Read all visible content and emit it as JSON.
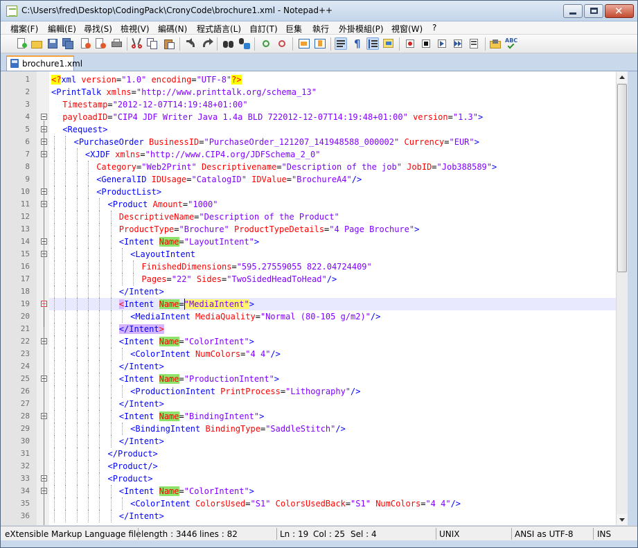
{
  "window": {
    "title": "C:\\Users\\fred\\Desktop\\CodingPack\\CronyCode\\brochure1.xml - Notepad++"
  },
  "menu": [
    "檔案(F)",
    "編輯(E)",
    "尋找(S)",
    "檢視(V)",
    "編碼(N)",
    "程式語言(L)",
    "自訂(T)",
    "巨集",
    "執行",
    "外掛模組(P)",
    "視窗(W)",
    "?"
  ],
  "toolbar": {
    "icons": [
      "new-file-icon",
      "open-file-icon",
      "save-icon",
      "save-all-icon",
      "close-icon",
      "close-all-icon",
      "print-icon",
      "cut-icon",
      "copy-icon",
      "paste-icon",
      "undo-icon",
      "redo-icon",
      "find-icon",
      "replace-icon",
      "zoom-in-icon",
      "zoom-out-icon",
      "sync-vertical-icon",
      "sync-horizontal-icon",
      "word-wrap-icon",
      "show-all-chars-icon",
      "indent-guide-icon",
      "language-define-icon",
      "record-macro-icon",
      "stop-macro-icon",
      "play-macro-icon",
      "run-macro-multiple-icon",
      "save-macro-icon",
      "function-list-icon",
      "spell-check-icon"
    ]
  },
  "tab": {
    "label": "brochure1.xml"
  },
  "editor": {
    "lines": [
      {
        "n": "1",
        "indent": 0,
        "html": "<span class=\"pi\">&lt;?</span><span class=\"tag\">xml</span> <span class=\"attr\">version</span>=<span class=\"val\">\"1.0\"</span> <span class=\"attr\">encoding</span>=<span class=\"val\">\"UTF-8\"</span><span class=\"pi\">?&gt;</span>"
      },
      {
        "n": "2",
        "indent": 0,
        "html": "<span class=\"tag\">&lt;PrintTalk</span> <span class=\"attr\">xmlns</span>=<span class=\"val\">\"http://www.printtalk.org/schema_13\"</span>"
      },
      {
        "n": "3",
        "indent": 1,
        "html": "<span class=\"attr\">Timestamp</span>=<span class=\"val\">\"2012-12-07T14:19:48+01:00\"</span>"
      },
      {
        "n": "4",
        "indent": 1,
        "html": "<span class=\"attr\">payloadID</span>=<span class=\"val\">\"CIP4 JDF Writer Java 1.4a BLD 722012-12-07T14:19:48+01:00\"</span> <span class=\"attr\">version</span>=<span class=\"val\">\"1.3\"</span><span class=\"tag\">&gt;</span>"
      },
      {
        "n": "5",
        "indent": 1,
        "html": "<span class=\"tag\">&lt;Request&gt;</span>"
      },
      {
        "n": "6",
        "indent": 2,
        "html": "<span class=\"tag\">&lt;PurchaseOrder</span> <span class=\"attr\">BusinessID</span>=<span class=\"val\">\"PurchaseOrder_121207_141948588_000002\"</span> <span class=\"attr\">Currency</span>=<span class=\"val\">\"EUR\"</span><span class=\"tag\">&gt;</span>"
      },
      {
        "n": "7",
        "indent": 3,
        "html": "<span class=\"tag\">&lt;XJDF</span> <span class=\"attr\">xmlns</span>=<span class=\"val\">\"http://www.CIP4.org/JDFSchema_2_0\"</span>"
      },
      {
        "n": "8",
        "indent": 4,
        "html": "<span class=\"attr\">Category</span>=<span class=\"val\">\"Web2Print\"</span> <span class=\"attr\">Descriptivename</span>=<span class=\"val\">\"Description of the job\"</span> <span class=\"attr\">JobID</span>=<span class=\"val\">\"Job388589\"</span><span class=\"tag\">&gt;</span>"
      },
      {
        "n": "9",
        "indent": 4,
        "html": "<span class=\"tag\">&lt;GeneralID</span> <span class=\"attr\">IDUsage</span>=<span class=\"val\">\"CatalogID\"</span> <span class=\"attr\">IDValue</span>=<span class=\"val\">\"BrochureA4\"</span><span class=\"tag\">/&gt;</span>"
      },
      {
        "n": "10",
        "indent": 4,
        "html": "<span class=\"tag\">&lt;ProductList&gt;</span>"
      },
      {
        "n": "11",
        "indent": 5,
        "html": "<span class=\"tag\">&lt;Product</span> <span class=\"attr\">Amount</span>=<span class=\"val\">\"1000\"</span>"
      },
      {
        "n": "12",
        "indent": 6,
        "html": "<span class=\"attr\">DescriptiveName</span>=<span class=\"val\">\"Description of the Product\"</span>"
      },
      {
        "n": "13",
        "indent": 6,
        "html": "<span class=\"attr\">ProductType</span>=<span class=\"val\">\"Brochure\"</span> <span class=\"attr\">ProductTypeDetails</span>=<span class=\"val\">\"4 Page Brochure\"</span><span class=\"tag\">&gt;</span>"
      },
      {
        "n": "14",
        "indent": 6,
        "html": "<span class=\"tag\">&lt;Intent</span> <span class=\"attr hlname\">Name</span>=<span class=\"val\">\"LayoutIntent\"</span><span class=\"tag\">&gt;</span>"
      },
      {
        "n": "15",
        "indent": 7,
        "html": "<span class=\"tag\">&lt;LayoutIntent</span>"
      },
      {
        "n": "16",
        "indent": 8,
        "html": "<span class=\"attr\">FinishedDimensions</span>=<span class=\"val\">\"595.27559055 822.04724409\"</span>"
      },
      {
        "n": "17",
        "indent": 8,
        "html": "<span class=\"attr\">Pages</span>=<span class=\"val\">\"22\"</span> <span class=\"attr\">Sides</span>=<span class=\"val\">\"TwoSidedHeadToHead\"</span><span class=\"tag\">/&gt;</span>"
      },
      {
        "n": "18",
        "indent": 6,
        "html": "<span class=\"tag\">&lt;/Intent&gt;</span>"
      },
      {
        "n": "19",
        "indent": 6,
        "current": true,
        "html": "<span class=\"brace-match\">&lt;</span><span class=\"tag\">Intent</span> <span class=\"hlname-cur\">Na</span><span class=\"hlname\" style=\"color:#ff0000\">me</span>=<span class=\"val cur-attrval\">\"MediaIntent\"</span><span class=\"tag\">&gt;</span>"
      },
      {
        "n": "20",
        "indent": 7,
        "html": "<span class=\"tag\">&lt;MediaIntent</span> <span class=\"attr\">MediaQuality</span>=<span class=\"val\">\"Normal (80-105 g/m2)\"</span><span class=\"tag\">/&gt;</span>"
      },
      {
        "n": "21",
        "indent": 6,
        "html": "<span class=\"tag\" style=\"background:#d6b5ff\">&lt;/Intent</span><span class=\"brace-match\">&gt;</span>"
      },
      {
        "n": "22",
        "indent": 6,
        "html": "<span class=\"tag\">&lt;Intent</span> <span class=\"attr hlname\">Name</span>=<span class=\"val\">\"ColorIntent\"</span><span class=\"tag\">&gt;</span>"
      },
      {
        "n": "23",
        "indent": 7,
        "html": "<span class=\"tag\">&lt;ColorIntent</span> <span class=\"attr\">NumColors</span>=<span class=\"val\">\"4 4\"</span><span class=\"tag\">/&gt;</span>"
      },
      {
        "n": "24",
        "indent": 6,
        "html": "<span class=\"tag\">&lt;/Intent&gt;</span>"
      },
      {
        "n": "25",
        "indent": 6,
        "html": "<span class=\"tag\">&lt;Intent</span> <span class=\"attr hlname\">Name</span>=<span class=\"val\">\"ProductionIntent\"</span><span class=\"tag\">&gt;</span>"
      },
      {
        "n": "26",
        "indent": 7,
        "html": "<span class=\"tag\">&lt;ProductionIntent</span> <span class=\"attr\">PrintProcess</span>=<span class=\"val\">\"Lithography\"</span><span class=\"tag\">/&gt;</span>"
      },
      {
        "n": "27",
        "indent": 6,
        "html": "<span class=\"tag\">&lt;/Intent&gt;</span>"
      },
      {
        "n": "28",
        "indent": 6,
        "html": "<span class=\"tag\">&lt;Intent</span> <span class=\"attr hlname\">Name</span>=<span class=\"val\">\"BindingIntent\"</span><span class=\"tag\">&gt;</span>"
      },
      {
        "n": "29",
        "indent": 7,
        "html": "<span class=\"tag\">&lt;BindingIntent</span> <span class=\"attr\">BindingType</span>=<span class=\"val\">\"SaddleStitch\"</span><span class=\"tag\">/&gt;</span>"
      },
      {
        "n": "30",
        "indent": 6,
        "html": "<span class=\"tag\">&lt;/Intent&gt;</span>"
      },
      {
        "n": "31",
        "indent": 5,
        "html": "<span class=\"tag\">&lt;/Product&gt;</span>"
      },
      {
        "n": "32",
        "indent": 5,
        "html": "<span class=\"tag\">&lt;Product/&gt;</span>"
      },
      {
        "n": "33",
        "indent": 5,
        "html": "<span class=\"tag\">&lt;Product&gt;</span>"
      },
      {
        "n": "34",
        "indent": 6,
        "html": "<span class=\"tag\">&lt;Intent</span> <span class=\"attr hlname\">Name</span>=<span class=\"val\">\"ColorIntent\"</span><span class=\"tag\">&gt;</span>"
      },
      {
        "n": "35",
        "indent": 7,
        "html": "<span class=\"tag\">&lt;ColorIntent</span> <span class=\"attr\">ColorsUsed</span>=<span class=\"val\">\"S1\"</span> <span class=\"attr\">ColorsUsedBack</span>=<span class=\"val\">\"S1\"</span> <span class=\"attr\">NumColors</span>=<span class=\"val\">\"4 4\"</span><span class=\"tag\">/&gt;</span>"
      },
      {
        "n": "36",
        "indent": 6,
        "html": "<span class=\"tag\">&lt;/Intent&gt;</span>"
      }
    ],
    "fold_markers": [
      "4",
      "5",
      "6",
      "7",
      "10",
      "11",
      "14",
      "15",
      "19",
      "22",
      "25",
      "28",
      "33",
      "34"
    ],
    "current_line": "19",
    "colors": {
      "tag": "#0000ff",
      "attribute": "#ff0000",
      "value": "#8000ff",
      "current_line_bg": "#e8e8ff"
    }
  },
  "status": {
    "filetype": "eXtensible Markup Language file",
    "length": "length : 3446",
    "lines": "lines : 82",
    "ln": "Ln : 19",
    "col": "Col : 25",
    "sel": "Sel : 4",
    "eol": "UNIX",
    "encoding": "ANSI as UTF-8",
    "mode": "INS"
  }
}
